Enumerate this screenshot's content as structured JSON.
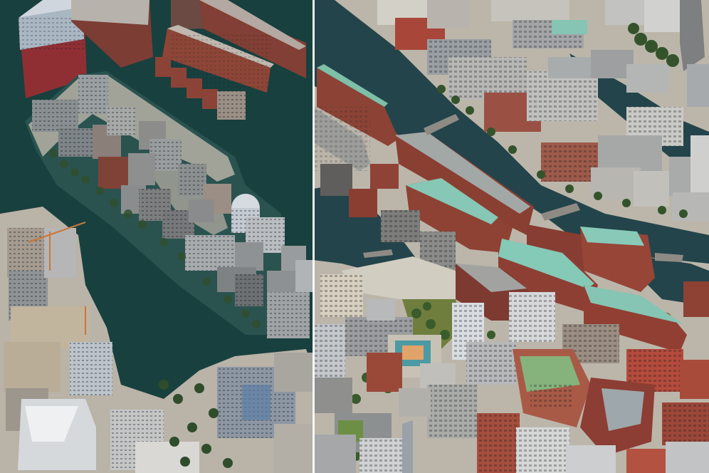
{
  "view": {
    "kind": "aerial-3d-comparison",
    "left_pane_style": "water-tinted",
    "right_pane_style": "textured"
  },
  "colors": {
    "water_left": "#1d4746",
    "water_right": "#23444a",
    "promenade": "#b9b3a7",
    "brick": "#8a4a3c",
    "roof_green": "#7fbfa9",
    "roof_gray": "#9aa0a4",
    "concrete": "#c9c7c1",
    "tree": "#3b5a2a",
    "glass": "#7e9fb6",
    "divider": "#ffffff"
  }
}
